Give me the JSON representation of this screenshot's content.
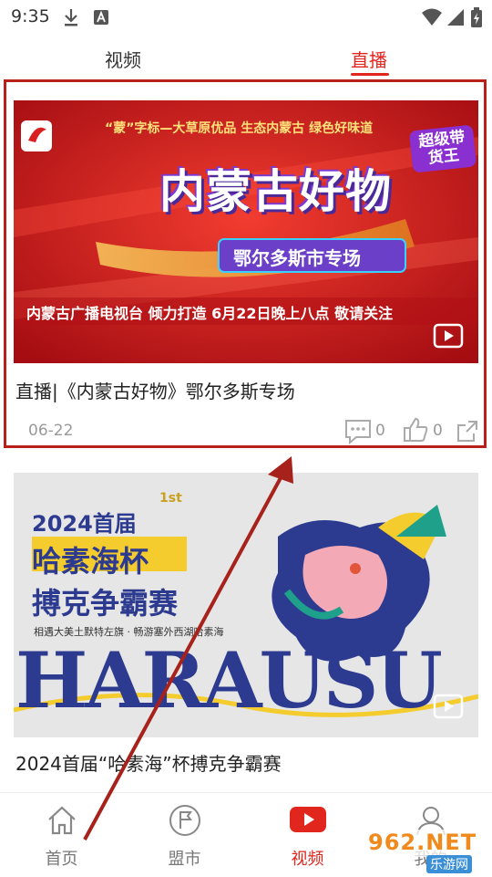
{
  "status": {
    "time": "9:35"
  },
  "tabs": [
    {
      "label": "视频"
    },
    {
      "label": "直播"
    }
  ],
  "cards": [
    {
      "banner_top": "“蒙”字标—大草原优品  生态内蒙古  绿色好味道",
      "banner_logo_text": "内蒙古好物",
      "banner_badge": "鄂尔多斯市专场",
      "banner_bottom": "内蒙古广播电视台 倾力打造  6月22日晚上八点 敬请关注",
      "super_label": "超级带货王",
      "title": "直播|《内蒙古好物》鄂尔多斯专场",
      "date": "06-22",
      "comments": "0",
      "likes": "0"
    },
    {
      "poster_year": "2024首届",
      "poster_1st": "1st",
      "poster_line1": "哈素海杯",
      "poster_line2": "搏克争霸赛",
      "poster_sub": "相遇大美土默特左旗 · 畅游塞外西湖哈素海",
      "poster_big": "HARAUSU",
      "title": "2024首届“哈素海”杯搏克争霸赛"
    }
  ],
  "nav": [
    {
      "label": "首页",
      "icon": "home-icon"
    },
    {
      "label": "盟市",
      "icon": "flag-icon"
    },
    {
      "label": "视频",
      "icon": "play-icon"
    },
    {
      "label": "我的",
      "icon": "user-icon"
    }
  ],
  "watermark": {
    "brand": "962.NET",
    "sub": "乐游网"
  },
  "colors": {
    "accent": "#e0261d",
    "highlight": "#b8201a",
    "arrow": "#a8221c"
  }
}
